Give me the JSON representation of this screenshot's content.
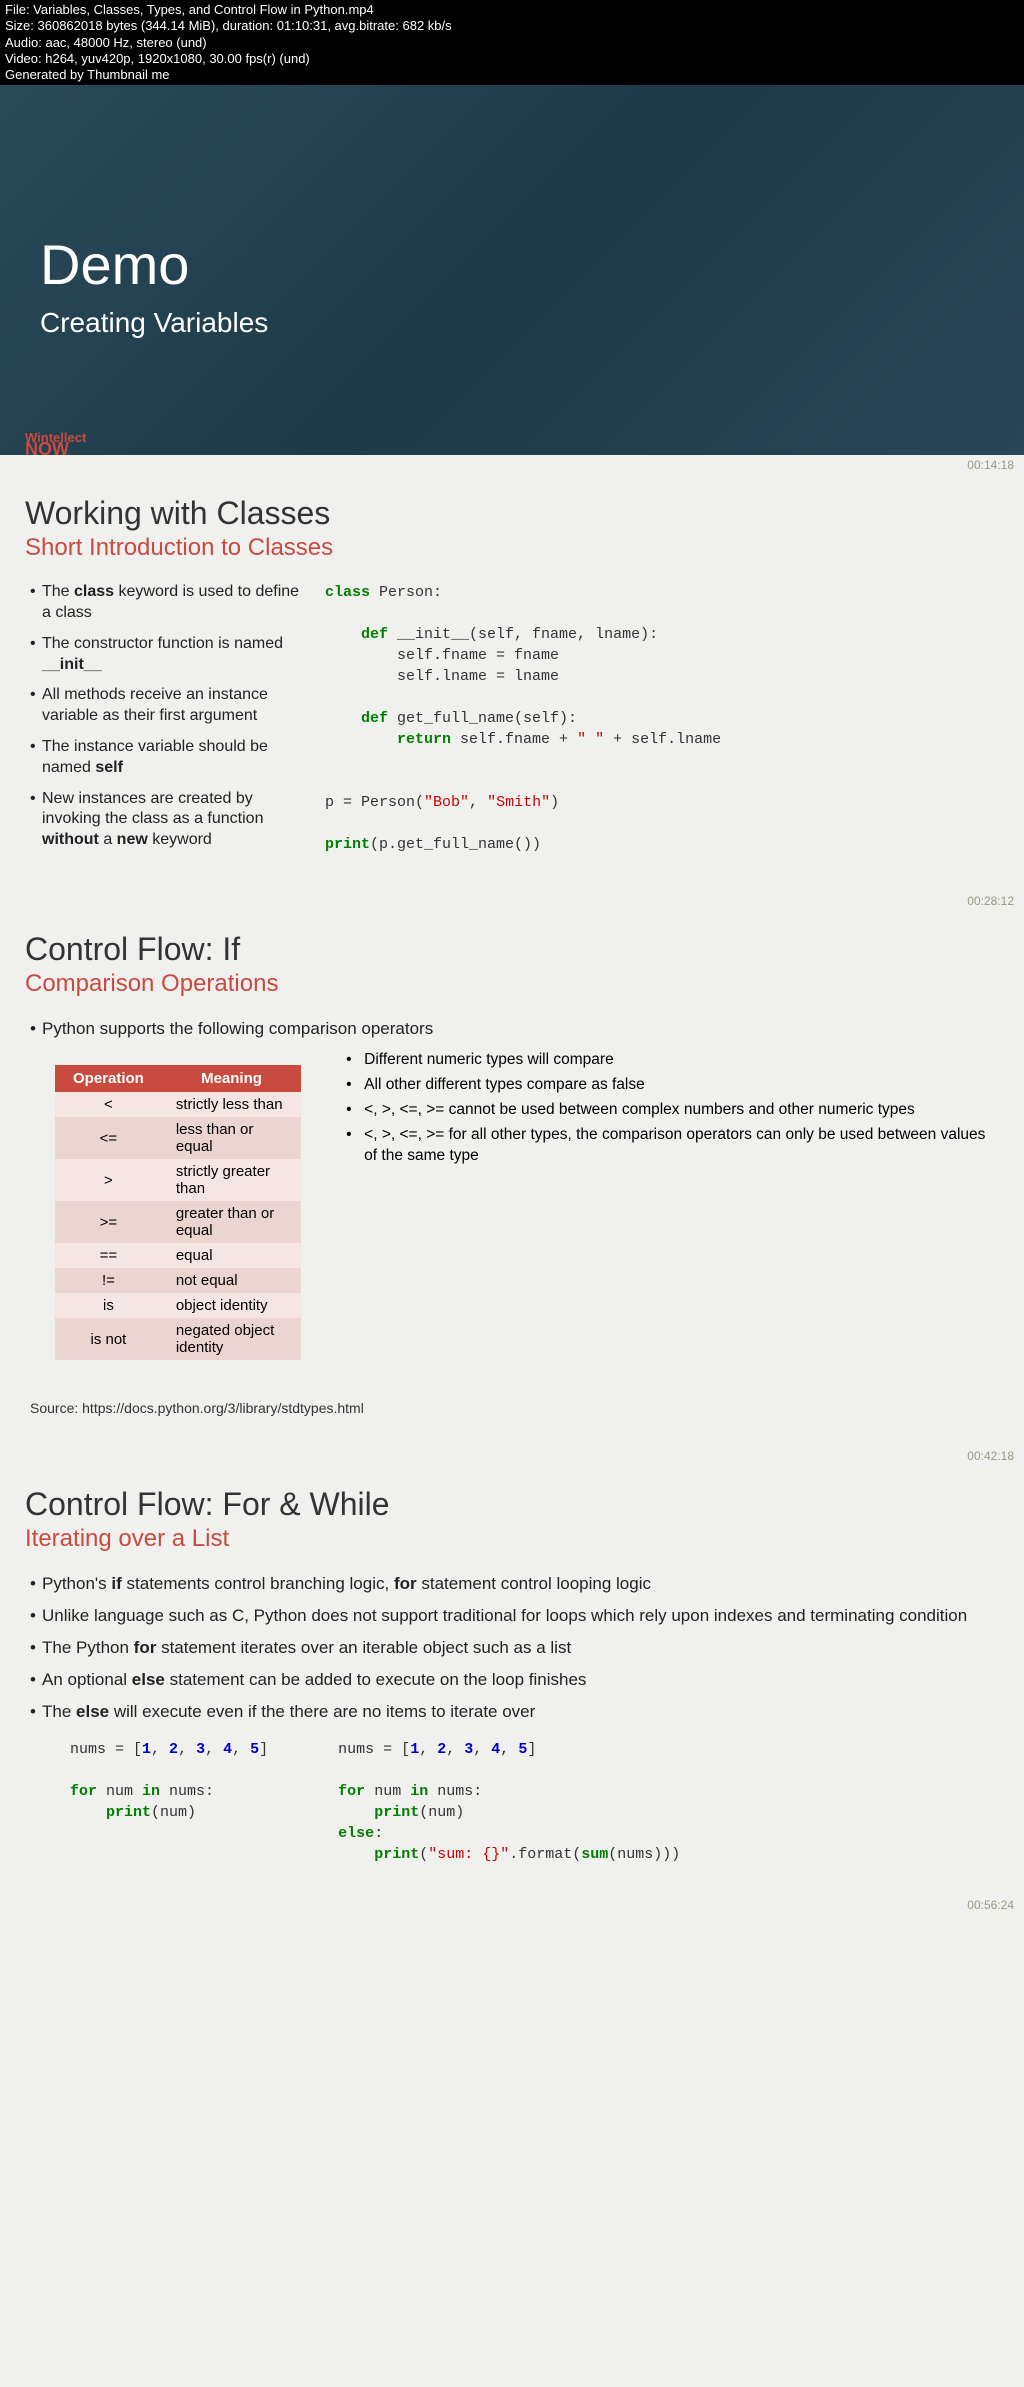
{
  "header": {
    "file": "File: Variables, Classes, Types, and Control Flow in Python.mp4",
    "size": "Size: 360862018 bytes (344.14 MiB), duration: 01:10:31, avg.bitrate: 682 kb/s",
    "audio": "Audio: aac, 48000 Hz, stereo (und)",
    "video": "Video: h264, yuv420p, 1920x1080, 30.00 fps(r) (und)",
    "gen": "Generated by Thumbnail me"
  },
  "demo": {
    "title": "Demo",
    "sub": "Creating Variables",
    "logo1": "Wintellect",
    "logo2": "NOW"
  },
  "ts": {
    "t1": "00:14:18",
    "t2": "00:28:12",
    "t3": "00:42:18",
    "t4": "00:56:24"
  },
  "slide1": {
    "title": "Working with Classes",
    "sub": "Short Introduction to Classes",
    "b1a": "The ",
    "b1b": "class",
    "b1c": " keyword is used to define a class",
    "b2a": "The constructor function is named ",
    "b2b": "__init__",
    "b3": "All methods receive an instance variable as their first argument",
    "b4a": "The instance variable should be named ",
    "b4b": "self",
    "b5a": "New instances are created by invoking the class as a function ",
    "b5b": "without",
    "b5c": " a ",
    "b5d": "new",
    "b5e": " keyword"
  },
  "slide2": {
    "title": "Control Flow: If",
    "sub": "Comparison Operations",
    "b1": "Python supports the following comparison operators",
    "th1": "Operation",
    "th2": "Meaning",
    "ops": [
      {
        "op": "<",
        "m": "strictly less than"
      },
      {
        "op": "<=",
        "m": "less than or equal"
      },
      {
        "op": ">",
        "m": "strictly greater than"
      },
      {
        "op": ">=",
        "m": "greater than or equal"
      },
      {
        "op": "==",
        "m": "equal"
      },
      {
        "op": "!=",
        "m": "not equal"
      },
      {
        "op": "is",
        "m": "object identity"
      },
      {
        "op": "is not",
        "m": "negated object identity"
      }
    ],
    "n1": "Different numeric types will compare",
    "n2": "All other different types compare as false",
    "n3": "<, >, <=, >= cannot be used between complex numbers and other numeric types",
    "n4": "<, >, <=, >= for all other types, the comparison operators can only be used between values of the same type",
    "source": "Source: https://docs.python.org/3/library/stdtypes.html"
  },
  "slide3": {
    "title": "Control Flow: For & While",
    "sub": "Iterating over a List",
    "b1a": "Python's ",
    "b1b": "if",
    "b1c": " statements control branching logic, ",
    "b1d": "for",
    "b1e": " statement control looping logic",
    "b2": "Unlike language such as C, Python does not support traditional for loops which rely upon indexes and terminating condition",
    "b3a": "The Python ",
    "b3b": "for",
    "b3c": " statement iterates over an iterable object such as a list",
    "b4a": "An optional ",
    "b4b": "else",
    "b4c": " statement can be added to execute on the loop finishes",
    "b5a": "The ",
    "b5b": "else",
    "b5c": " will execute even if the there are no items to iterate over"
  },
  "code": {
    "c1_l1a": "class",
    "c1_l1b": " Person:",
    "c1_l2a": "def",
    "c1_l2b": " __init__(self, fname, lname):",
    "c1_l3": "self.fname = fname",
    "c1_l4": "self.lname = lname",
    "c1_l5a": "def",
    "c1_l5b": " get_full_name(self):",
    "c1_l6a": "return",
    "c1_l6b": " self.fname + ",
    "c1_l6c": "\" \"",
    "c1_l6d": " + self.lname",
    "c1_l7a": "p = Person(",
    "c1_l7b": "\"Bob\"",
    "c1_l7c": ", ",
    "c1_l7d": "\"Smith\"",
    "c1_l7e": ")",
    "c1_l8a": "print",
    "c1_l8b": "(p.get_full_name())",
    "c2_l1a": "nums = [",
    "c2_l1b": "1",
    "c2_l1c": ", ",
    "c2_l1d": "2",
    "c2_l1e": ", ",
    "c2_l1f": "3",
    "c2_l1g": ", ",
    "c2_l1h": "4",
    "c2_l1i": ", ",
    "c2_l1j": "5",
    "c2_l1k": "]",
    "c2_l2a": "for",
    "c2_l2b": " num ",
    "c2_l2c": "in",
    "c2_l2d": " nums:",
    "c2_l3a": "print",
    "c2_l3b": "(num)",
    "c3_l4": "else",
    "c3_l5a": "print",
    "c3_l5b": "(",
    "c3_l5c": "\"sum: {}\"",
    "c3_l5d": ".format(",
    "c3_l5e": "sum",
    "c3_l5f": "(nums)))"
  }
}
